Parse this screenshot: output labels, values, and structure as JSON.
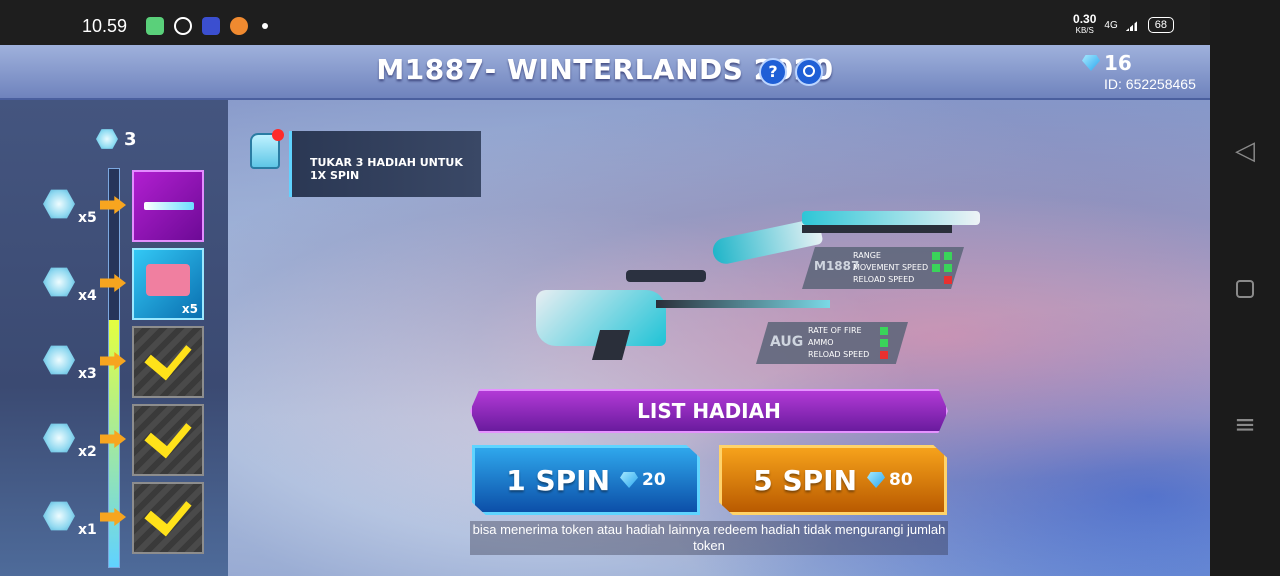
{
  "status_bar": {
    "time": "10.59",
    "network_speed": "0.30",
    "network_unit": "KB/S",
    "network_type": "4G",
    "battery": "68"
  },
  "header": {
    "title": "M1887- WINTERLANDS 2020",
    "help_icon": "?",
    "diamonds": "16",
    "player_id": "ID: 652258465"
  },
  "progress": {
    "token_count": "3",
    "tiers": [
      {
        "multiplier": "x5",
        "reward_label": "",
        "status": "available"
      },
      {
        "multiplier": "x4",
        "reward_label": "x5",
        "status": "available"
      },
      {
        "multiplier": "x3",
        "reward_label": "",
        "status": "claimed"
      },
      {
        "multiplier": "x2",
        "reward_label": "",
        "status": "claimed"
      },
      {
        "multiplier": "x1",
        "reward_label": "",
        "status": "claimed"
      }
    ],
    "fill_fraction": 0.62
  },
  "info_tag": "TUKAR 3 HADIAH UNTUK 1X SPIN",
  "weapons": [
    {
      "name": "M1887",
      "stats": [
        {
          "label": "RANGE",
          "marks": [
            "up",
            "up"
          ]
        },
        {
          "label": "MOVEMENT SPEED",
          "marks": [
            "up",
            "up"
          ]
        },
        {
          "label": "RELOAD SPEED",
          "marks": [
            "down"
          ]
        }
      ]
    },
    {
      "name": "AUG",
      "stats": [
        {
          "label": "RATE OF FIRE",
          "marks": [
            "up"
          ]
        },
        {
          "label": "AMMO",
          "marks": [
            "up"
          ]
        },
        {
          "label": "RELOAD SPEED",
          "marks": [
            "down"
          ]
        }
      ]
    }
  ],
  "buttons": {
    "list_rewards": "LIST HADIAH",
    "spin_1": {
      "label": "1 SPIN",
      "cost": "20"
    },
    "spin_5": {
      "label": "5 SPIN",
      "cost": "80"
    }
  },
  "note": "bisa menerima token atau hadiah lainnya redeem hadiah tidak mengurangi jumlah token",
  "colors": {
    "accent_blue": "#2fa7ec",
    "accent_orange": "#f6a21b",
    "accent_purple": "#b23ad6"
  }
}
